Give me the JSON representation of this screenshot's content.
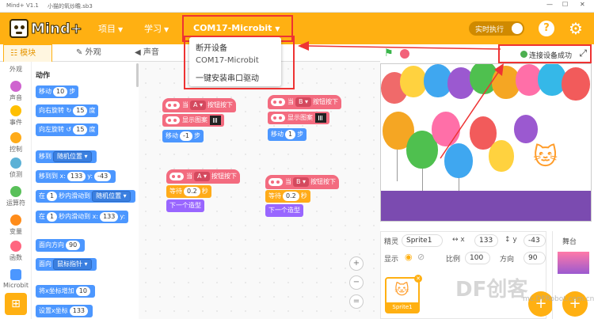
{
  "titlebar": {
    "app": "Mind+ V1.1",
    "file": "小猫的氧炒瞻.sb3",
    "min": "—",
    "max": "☐",
    "close": "✕"
  },
  "menubar": {
    "logo": "Mind+",
    "project": "项目",
    "learn": "学习",
    "com_port": "COM17-Microbit",
    "realtime": "实时执行",
    "help": "?",
    "settings_icon": "gear-icon"
  },
  "dropdown": {
    "items": [
      "断开设备",
      "COM17-Microbit",
      "一键安装串口驱动"
    ]
  },
  "tabs": {
    "blocks": "模块",
    "looks": "外观",
    "sound": "声音"
  },
  "stagebar": {
    "connected": "连接设备成功"
  },
  "categories": [
    {
      "label": "外观",
      "color": "#9966ff"
    },
    {
      "label": "声音",
      "color": "#cf63cf"
    },
    {
      "label": "事件",
      "color": "#ffbf00"
    },
    {
      "label": "控制",
      "color": "#ffab19"
    },
    {
      "label": "侦测",
      "color": "#5cb1d6"
    },
    {
      "label": "运算符",
      "color": "#59c059"
    },
    {
      "label": "变量",
      "color": "#ff8c1a"
    },
    {
      "label": "函数",
      "color": "#ff6680"
    },
    {
      "label": "Microbit",
      "color": "#4c97ff"
    }
  ],
  "palette": {
    "section": "动作",
    "move": "移动",
    "move_n": "10",
    "move_unit": "步",
    "turn_right": "向右旋转",
    "turn_right_n": "15",
    "deg": "度",
    "turn_left": "向左旋转",
    "turn_left_n": "15",
    "goto": "移到",
    "goto_opt": "随机位置",
    "goto_xy": "移到到 x:",
    "goto_x": "133",
    "goto_y_label": "y:",
    "goto_y": "-43",
    "glide1_pre": "在",
    "glide1_n": "1",
    "glide1_mid": "秒内滑动到",
    "glide1_opt": "随机位置",
    "glide2_pre": "在",
    "glide2_n": "1",
    "glide2_mid": "秒内滑动到 x:",
    "glide2_x": "133",
    "glide2_y_label": "y:",
    "point_dir": "面向方向",
    "point_dir_n": "90",
    "point_to": "面向",
    "point_to_opt": "鼠标指针",
    "change_x": "将x坐标增加",
    "change_x_n": "10",
    "set_x": "设置x坐标",
    "set_x_n": "133"
  },
  "workspace": {
    "s1_when": "当",
    "s1_btn": "A",
    "s1_pressed": "按钮按下",
    "s1_show": "显示图案",
    "s1_move": "移动",
    "s1_move_n": "-1",
    "s1_unit": "步",
    "s2_when": "当",
    "s2_btn": "B",
    "s2_pressed": "按钮按下",
    "s2_show": "显示图案",
    "s2_move": "移动",
    "s2_move_n": "1",
    "s2_unit": "步",
    "s3_when": "当",
    "s3_btn": "A",
    "s3_pressed": "按钮按下",
    "s3_wait": "等待",
    "s3_wait_n": "0.2",
    "s3_sec": "秒",
    "s3_next": "下一个造型",
    "s4_when": "当",
    "s4_btn": "B",
    "s4_pressed": "按钮按下",
    "s4_wait": "等待",
    "s4_wait_n": "0.2",
    "s4_sec": "秒",
    "s4_next": "下一个造型",
    "zoom_in": "+",
    "zoom_out": "−",
    "zoom_reset": "="
  },
  "sprite_info": {
    "sprite_label": "精灵",
    "sprite_name": "Sprite1",
    "x_label": "x",
    "x_val": "133",
    "y_label": "y",
    "y_val": "-43",
    "show_label": "显示",
    "size_label": "比例",
    "size_val": "100",
    "dir_label": "方向",
    "dir_val": "90",
    "card_name": "Sprite1",
    "stage_label": "舞台"
  },
  "watermark": {
    "big": "DF创客",
    "small": "mc.DFRobot.com.cn"
  }
}
